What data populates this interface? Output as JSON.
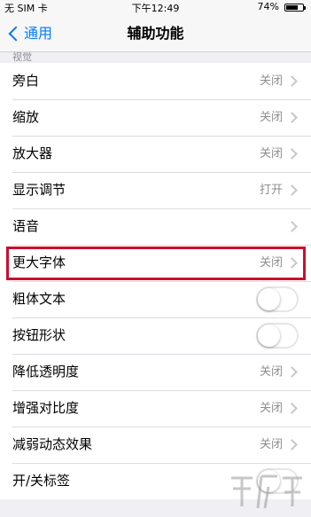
{
  "status_bar": {
    "carrier": "无 SIM 卡",
    "time": "下午12:49",
    "battery": "74%"
  },
  "nav": {
    "back_label": "通用",
    "title": "辅助功能"
  },
  "section_header": "视觉",
  "rows": [
    {
      "label": "旁白",
      "value": "关闭"
    },
    {
      "label": "缩放",
      "value": "关闭"
    },
    {
      "label": "放大器",
      "value": "关闭"
    },
    {
      "label": "显示调节",
      "value": "打开"
    },
    {
      "label": "语音",
      "value": ""
    },
    {
      "label": "更大字体",
      "value": "关闭",
      "highlighted": true
    },
    {
      "label": "粗体文本",
      "toggle": false
    },
    {
      "label": "按钮形状",
      "toggle": false
    },
    {
      "label": "降低透明度",
      "value": "关闭"
    },
    {
      "label": "增强对比度",
      "value": "关闭"
    },
    {
      "label": "减弱动态效果",
      "value": "关闭"
    },
    {
      "label": "开/关标签",
      "toggle": false
    }
  ],
  "colors": {
    "accent": "#007aff",
    "highlight": "#c8102e",
    "background": "#efeff4"
  }
}
